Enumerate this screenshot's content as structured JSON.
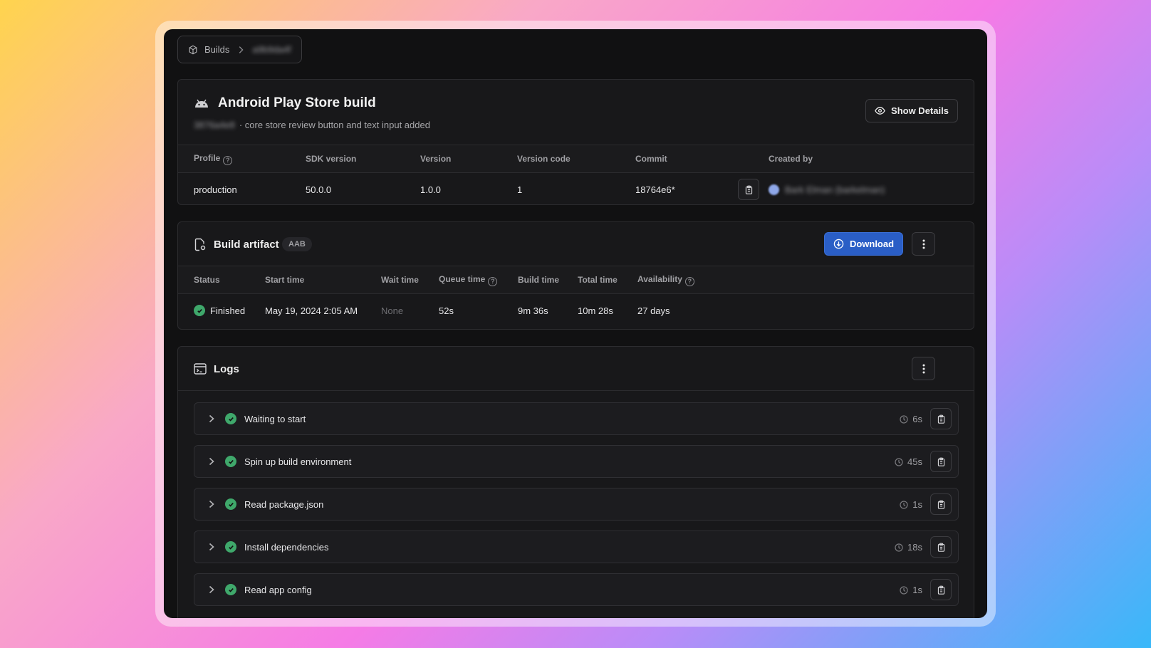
{
  "breadcrumb": {
    "root": "Builds",
    "current": "a9b9da4f"
  },
  "build": {
    "title": "Android Play Store build",
    "commit_hash_blurred": "3876a4e8",
    "description": "· core store review button and text input added",
    "show_details_label": "Show Details"
  },
  "info_table": {
    "headers": [
      "Profile",
      "SDK version",
      "Version",
      "Version code",
      "Commit",
      "Created by"
    ],
    "values": {
      "profile": "production",
      "sdk": "50.0.0",
      "version": "1.0.0",
      "version_code": "1",
      "commit": "18764e6*",
      "created_by": "Bark Elman (barkelman)"
    }
  },
  "artifact": {
    "title": "Build artifact",
    "badge": "AAB",
    "download_label": "Download",
    "headers": [
      "Status",
      "Start time",
      "Wait time",
      "Queue time",
      "Build time",
      "Total time",
      "Availability"
    ],
    "values": {
      "status": "Finished",
      "start": "May 19, 2024 2:05 AM",
      "wait": "None",
      "queue": "52s",
      "build": "9m 36s",
      "total": "10m 28s",
      "availability": "27 days"
    }
  },
  "logs": {
    "title": "Logs",
    "items": [
      {
        "name": "Waiting to start",
        "duration": "6s"
      },
      {
        "name": "Spin up build environment",
        "duration": "45s"
      },
      {
        "name": "Read package.json",
        "duration": "1s"
      },
      {
        "name": "Install dependencies",
        "duration": "18s"
      },
      {
        "name": "Read app config",
        "duration": "1s"
      }
    ]
  },
  "colors": {
    "accent": "#2a5ec6",
    "success": "#3fa86b",
    "background": "#111112"
  }
}
